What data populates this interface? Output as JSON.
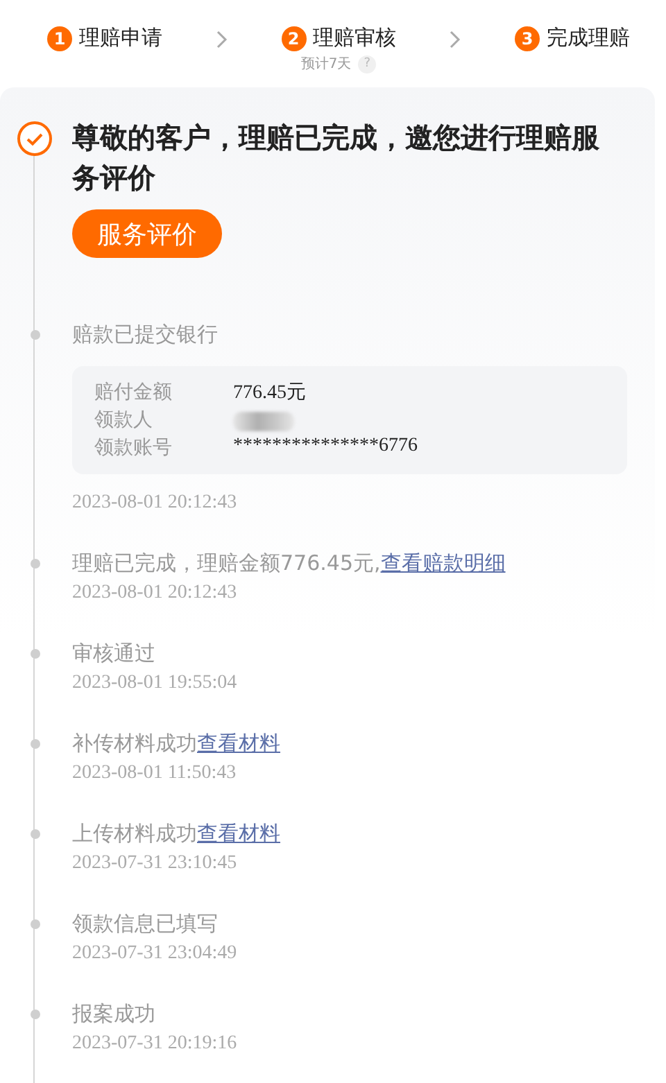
{
  "steps": [
    {
      "number": "1",
      "label": "理赔申请"
    },
    {
      "number": "2",
      "label": "理赔审核",
      "note": "预计7天",
      "help": "?"
    },
    {
      "number": "3",
      "label": "完成理赔"
    }
  ],
  "notice": {
    "title": "尊敬的客户，理赔已完成，邀您进行理赔服务评价",
    "button": "服务评价"
  },
  "events": [
    {
      "title": "赔款已提交银行",
      "details": [
        {
          "label": "赔付金额",
          "value": "776.45元",
          "kind": "text"
        },
        {
          "label": "领款人",
          "kind": "redacted"
        },
        {
          "label": "领款账号",
          "value": "***************6776",
          "kind": "text"
        }
      ],
      "time": "2023-08-01 20:12:43"
    },
    {
      "title": "理赔已完成，理赔金额776.45元,",
      "link": "查看赔款明细",
      "time": "2023-08-01 20:12:43"
    },
    {
      "title": "审核通过",
      "time": "2023-08-01 19:55:04"
    },
    {
      "title": "补传材料成功",
      "link": "查看材料",
      "time": "2023-08-01 11:50:43"
    },
    {
      "title": "上传材料成功",
      "link": "查看材料",
      "time": "2023-07-31 23:10:45"
    },
    {
      "title": "领款信息已填写",
      "time": "2023-07-31 23:04:49"
    },
    {
      "title": "报案成功",
      "time": "2023-07-31 20:19:16"
    }
  ]
}
